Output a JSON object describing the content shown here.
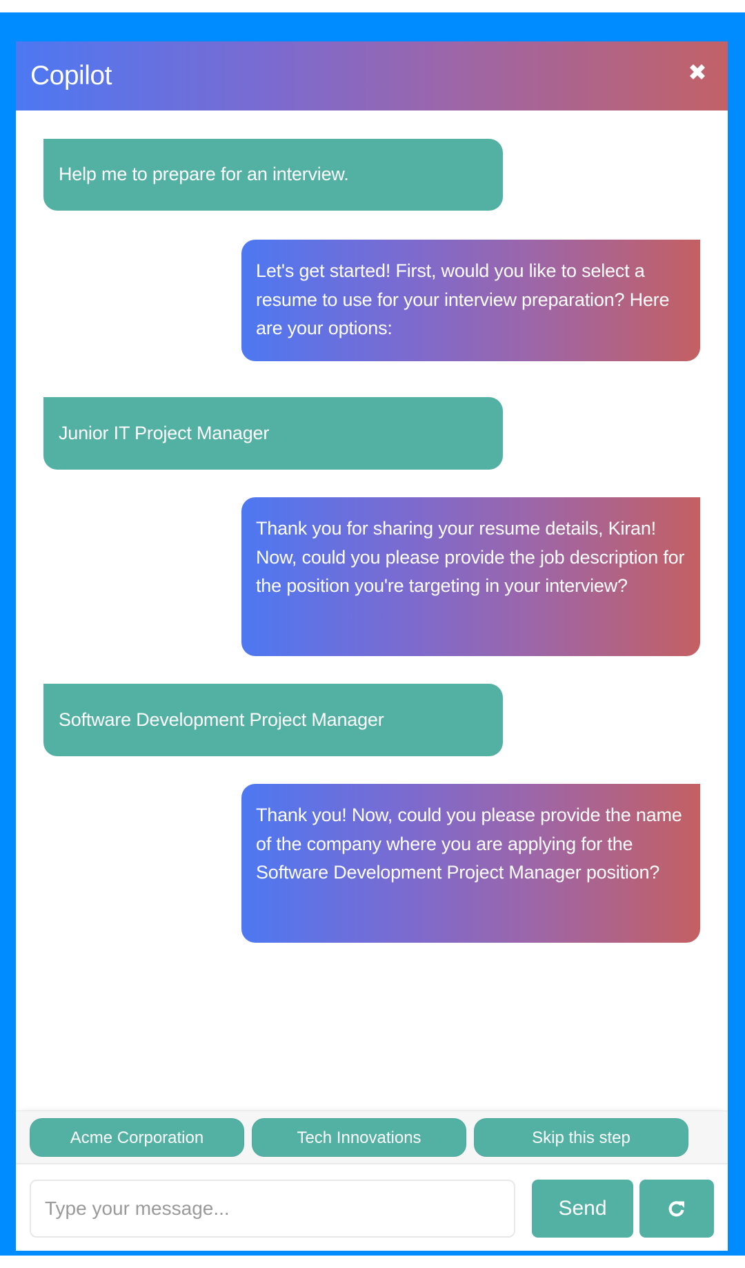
{
  "header": {
    "title": "Copilot",
    "close_icon": "close-icon"
  },
  "messages": [
    {
      "sender": "user",
      "text": "Help me to prepare for an interview."
    },
    {
      "sender": "bot",
      "text": "Let's get started! First, would you like to select a resume to use for your interview preparation? Here are your options:"
    },
    {
      "sender": "user",
      "text": "Junior IT Project Manager"
    },
    {
      "sender": "bot",
      "text": "Thank you for sharing your resume details, Kiran! Now, could you please provide the job description for the position you're targeting in your interview?"
    },
    {
      "sender": "user",
      "text": "Software Development Project Manager"
    },
    {
      "sender": "bot",
      "text": "Thank you! Now, could you please provide the name of the company where you are applying for the Software Development Project Manager position?"
    }
  ],
  "quick_replies": [
    {
      "label": "Acme Corporation"
    },
    {
      "label": "Tech Innovations"
    },
    {
      "label": "Skip this step"
    }
  ],
  "composer": {
    "value": "",
    "placeholder": "Type your message...",
    "send_label": "Send",
    "refresh_icon": "refresh-icon"
  },
  "colors": {
    "frame_border": "#008cff",
    "user_bubble": "#53b1a3",
    "gradient_start": "#4d78f2",
    "gradient_end": "#c46063",
    "button": "#53b1a3"
  }
}
